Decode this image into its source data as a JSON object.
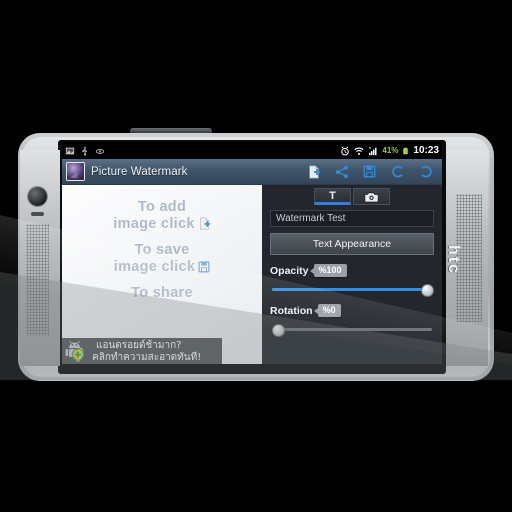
{
  "device": {
    "brand_label": "htc",
    "icons": {
      "camera": "camera-icon",
      "earpiece": "earpiece-slot",
      "speaker": "speaker-grille"
    }
  },
  "statusbar": {
    "left_icons": [
      "gallery-icon",
      "usb-icon",
      "sync-icon"
    ],
    "right_icons": [
      "alarm-icon",
      "wifi-icon",
      "signal-icon"
    ],
    "battery_percent": "41%",
    "battery_icon": "battery-icon",
    "clock": "10:23"
  },
  "actionbar": {
    "app_icon": "app-logo-icon",
    "title": "Picture Watermark",
    "actions": [
      {
        "name": "add-image-button",
        "icon": "add-file-icon"
      },
      {
        "name": "share-button",
        "icon": "share-icon"
      },
      {
        "name": "save-button",
        "icon": "save-icon"
      },
      {
        "name": "undo-button",
        "icon": "undo-icon"
      },
      {
        "name": "redo-button",
        "icon": "redo-icon"
      }
    ]
  },
  "canvas": {
    "hints": [
      {
        "line1": "To add",
        "line2": "image click",
        "icon": "add-file-icon"
      },
      {
        "line1": "To save",
        "line2": "image click",
        "icon": "floppy-save-icon"
      },
      {
        "line1": "To share",
        "line2": "",
        "icon": "share-icon"
      }
    ],
    "hint_color": "#aebacb"
  },
  "ad": {
    "icon": "android-shield-icon",
    "line1": "แอนดรอยด์ช้ามาก?",
    "line2": "คลิกทำความสะอาดทันที!",
    "background": "#555a5e"
  },
  "panel": {
    "tabs": [
      {
        "label": "T",
        "name": "tab-text",
        "selected": true
      },
      {
        "label": "",
        "name": "tab-image",
        "icon": "picture-icon",
        "selected": false
      }
    ],
    "accent": "#2f8fe0",
    "watermark_input": {
      "value": "Watermark Test",
      "placeholder": "Watermark Test"
    },
    "text_appearance_label": "Text Appearance",
    "opacity": {
      "label": "Opacity",
      "value_label": "%100",
      "percent": 100
    },
    "rotation": {
      "label": "Rotation",
      "value_label": "%0",
      "percent": 0
    }
  }
}
